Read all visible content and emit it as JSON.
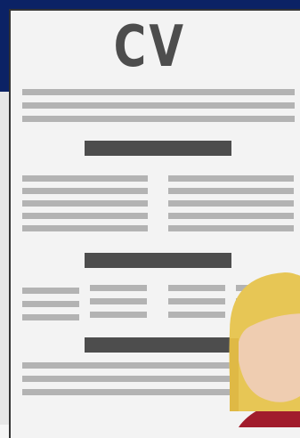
{
  "document": {
    "title": "CV"
  },
  "illustration": {
    "person_icon": "woman-avatar-icon",
    "colors": {
      "header_bg": "#0b2265",
      "paper": "#f3f3f3",
      "heading_bar": "#4d4d4d",
      "text_line": "#b3b3b3",
      "hair": "#e7c655",
      "skin": "#efcdb1",
      "shirt": "#a11c2c"
    }
  }
}
